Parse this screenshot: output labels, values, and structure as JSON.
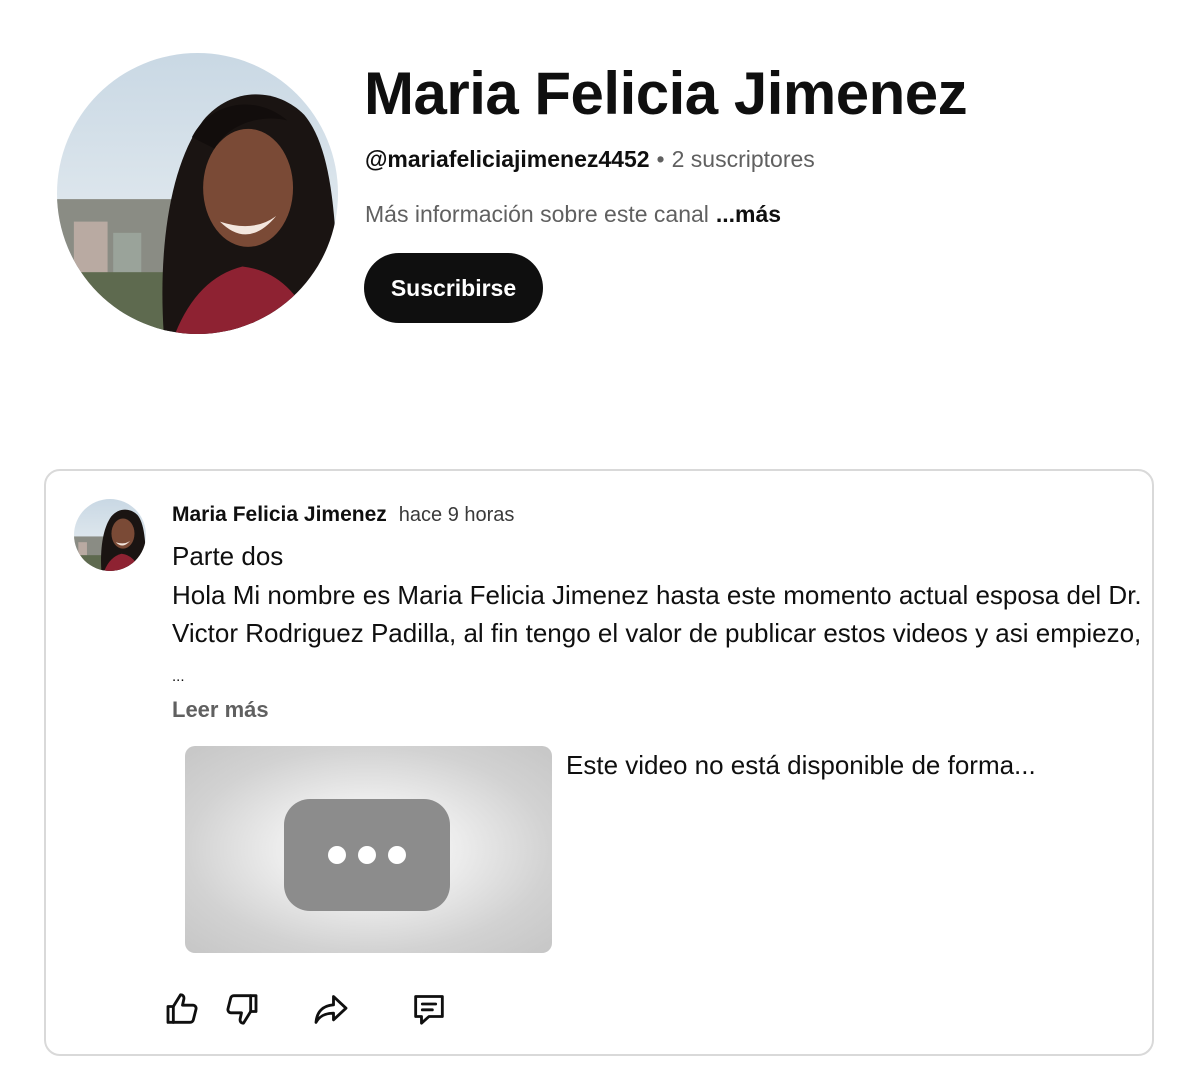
{
  "channel": {
    "name": "Maria Felicia Jimenez",
    "handle": "@mariafeliciajimenez4452",
    "separator": "•",
    "subscribers": "2 suscriptores",
    "about": "Más información sobre este canal",
    "about_more": "...más",
    "subscribe_label": "Suscribirse",
    "avatar_icon": "profile-photo"
  },
  "post": {
    "author": "Maria Felicia Jimenez",
    "time": "hace 9 horas",
    "title_line": "Parte dos",
    "body": "Hola Mi nombre es Maria Felicia Jimenez hasta este momento actual esposa del Dr. Victor Rodriguez Padilla, al fin tengo el valor de publicar estos videos y asi empiezo,",
    "body_ellipsis": "...",
    "read_more": "Leer más",
    "video": {
      "title": "Este video no está disponible de forma...",
      "thumbnail_icon": "unavailable-video-dots-icon"
    },
    "actions": [
      {
        "name": "like",
        "icon": "thumbs-up-icon"
      },
      {
        "name": "dislike",
        "icon": "thumbs-down-icon"
      },
      {
        "name": "share",
        "icon": "share-arrow-icon"
      },
      {
        "name": "comment",
        "icon": "comment-icon"
      }
    ]
  },
  "colors": {
    "text_primary": "#0f0f0f",
    "text_secondary": "#606060",
    "button_dark": "#0f0f0f",
    "card_border": "#d9d9d9",
    "thumbnail_bg": "#d2d2d2"
  }
}
